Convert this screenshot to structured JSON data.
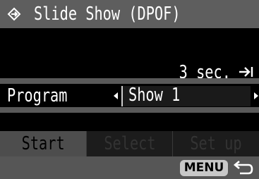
{
  "header": {
    "title": "Slide Show (DPOF)",
    "icon": "slideshow-icon"
  },
  "interval": {
    "value": "3 sec.",
    "icon": "arrow-right-bar-icon"
  },
  "program": {
    "label": "Program",
    "value": "Show 1"
  },
  "tabs": [
    {
      "label": "Start",
      "state": "selected"
    },
    {
      "label": "Select",
      "state": "disabled"
    },
    {
      "label": "Set up",
      "state": "disabled"
    }
  ],
  "footer": {
    "menu_label": "MENU",
    "back_icon": "return-arrow-icon"
  },
  "colors": {
    "header_bg": "#5e5e5e",
    "selected_tab_bg": "#4d4d4d",
    "menu_button_bg": "#c8c8c8"
  }
}
